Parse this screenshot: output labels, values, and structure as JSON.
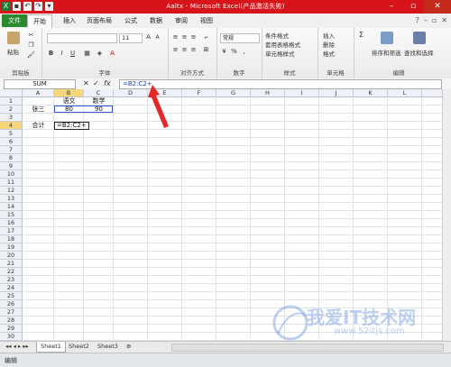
{
  "window": {
    "title": "Aaltx - Microsoft Excel(产品激活失败)",
    "qat_icons": [
      "save-icon",
      "undo-icon",
      "redo-icon",
      "dropdown-icon"
    ],
    "controls": [
      "minimize",
      "maximize",
      "close"
    ]
  },
  "tabs": [
    "文件",
    "开始",
    "插入",
    "页面布局",
    "公式",
    "数据",
    "审阅",
    "视图"
  ],
  "active_tab": "开始",
  "ribbon": {
    "groups": [
      {
        "label": "剪贴板",
        "items": [
          "粘贴"
        ]
      },
      {
        "label": "字体",
        "items": [
          "B",
          "I",
          "U",
          "A"
        ]
      },
      {
        "label": "对齐方式",
        "items": []
      },
      {
        "label": "数字",
        "items": [
          "常规",
          "%"
        ]
      },
      {
        "label": "样式",
        "items": [
          "条件格式",
          "套用表格格式",
          "单元格样式"
        ]
      },
      {
        "label": "单元格",
        "items": [
          "插入",
          "删除",
          "格式"
        ]
      },
      {
        "label": "编辑",
        "items": [
          "Σ",
          "排序和筛选",
          "查找和选择"
        ]
      }
    ],
    "font_size": "11"
  },
  "formula_bar": {
    "name_box": "SUM",
    "formula": "=B2:C2+"
  },
  "columns": [
    "A",
    "B",
    "C",
    "D",
    "E",
    "F",
    "G",
    "H",
    "I",
    "J",
    "K",
    "L"
  ],
  "rows": [
    "1",
    "2",
    "3",
    "4",
    "5",
    "6",
    "7",
    "8",
    "9",
    "10",
    "11",
    "12",
    "13",
    "14",
    "15",
    "16",
    "17",
    "18",
    "19",
    "20",
    "21",
    "22",
    "23",
    "24",
    "25",
    "26",
    "27",
    "28",
    "29",
    "30"
  ],
  "cells": {
    "B1": "语文",
    "C1": "数学",
    "A2": "张三",
    "B2": "80",
    "C2": "90",
    "A4": "合计",
    "B4": "=B2:C2+"
  },
  "sheets": [
    "Sheet1",
    "Sheet2",
    "Sheet3"
  ],
  "active_sheet": "Sheet1",
  "status": "编辑",
  "watermark": {
    "text": "我爱IT技术网",
    "sub": "www.52itjs.com"
  },
  "colors": {
    "title_bar": "#d7141a",
    "file_tab": "#2a8a2d",
    "selection": "#f7d57a",
    "arrow": "#e22828"
  }
}
